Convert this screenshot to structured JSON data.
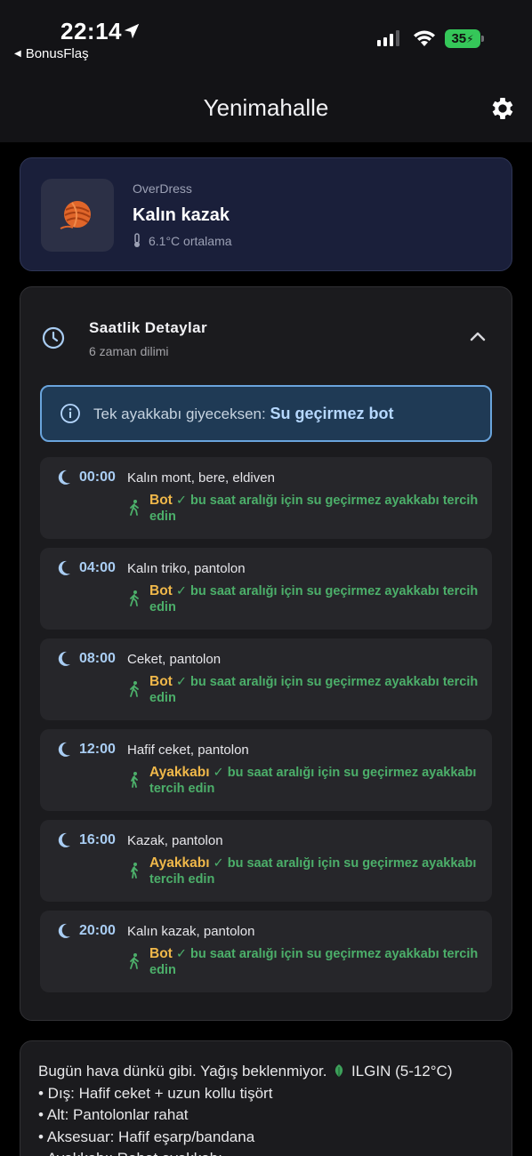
{
  "status_bar": {
    "time": "22:14",
    "back_app": "BonusFlaş",
    "battery": "35"
  },
  "nav": {
    "title": "Yenimahalle"
  },
  "summary": {
    "brand": "OverDress",
    "item": "Kalın kazak",
    "temperature": "6.1°C ortalama"
  },
  "hourly": {
    "title": "Saatlik Detaylar",
    "subtitle": "6 zaman dilimi",
    "tip_label": "Tek ayakkabı giyeceksen:",
    "tip_value": "Su geçirmez bot",
    "slots": [
      {
        "time": "00:00",
        "outfit": "Kalın mont, bere, eldiven",
        "shoe": "Bot",
        "note": "✓ bu saat aralığı için su geçirmez ayakkabı tercih edin"
      },
      {
        "time": "04:00",
        "outfit": "Kalın triko, pantolon",
        "shoe": "Bot",
        "note": "✓ bu saat aralığı için su geçirmez ayakkabı tercih edin"
      },
      {
        "time": "08:00",
        "outfit": "Ceket, pantolon",
        "shoe": "Bot",
        "note": "✓ bu saat aralığı için su geçirmez ayakkabı tercih edin"
      },
      {
        "time": "12:00",
        "outfit": "Hafif ceket, pantolon",
        "shoe": "Ayakkabı",
        "note": "✓ bu saat aralığı için su geçirmez ayakkabı tercih edin"
      },
      {
        "time": "16:00",
        "outfit": "Kazak, pantolon",
        "shoe": "Ayakkabı",
        "note": "✓ bu saat aralığı için su geçirmez ayakkabı tercih edin"
      },
      {
        "time": "20:00",
        "outfit": "Kalın kazak, pantolon",
        "shoe": "Bot",
        "note": "✓ bu saat aralığı için su geçirmez ayakkabı tercih edin"
      }
    ]
  },
  "note": {
    "intro": "Bugün hava dünkü gibi. Yağış beklenmiyor.",
    "range": "ILGIN (5-12°C)",
    "lines": [
      "• Dış: Hafif ceket + uzun kollu tişört",
      "• Alt: Pantolonlar rahat",
      "• Aksesuar: Hafif eşarp/bandana",
      "• Ayakkabı: Rahat ayakkabı"
    ]
  },
  "colors": {
    "accent_blue": "#a9cdf3",
    "shoe_orange": "#f0b84a",
    "ok_green": "#4caf6a",
    "summary_bg": "#1a1f3a"
  },
  "icons": [
    "location-arrow-icon",
    "signal-icon",
    "wifi-icon",
    "gear-icon",
    "yarn-ball-icon",
    "thermometer-icon",
    "clock-icon",
    "chevron-up-icon",
    "info-icon",
    "moon-icon",
    "walking-icon",
    "leaf-icon"
  ]
}
